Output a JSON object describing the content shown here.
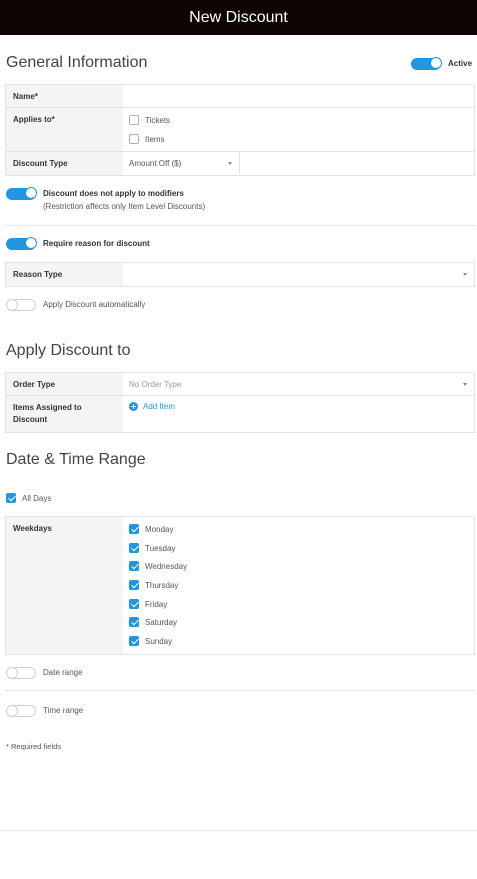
{
  "header": {
    "title": "New Discount"
  },
  "general": {
    "title": "General Information",
    "active_label": "Active",
    "name_label": "Name*",
    "name_value": "",
    "applies_label": "Applies to*",
    "applies_options": [
      "Tickets",
      "Items"
    ],
    "discount_type_label": "Discount Type",
    "discount_type_value": "Amount Off ($)",
    "modifiers_label": "Discount does not apply to modifiers",
    "modifiers_sub": "(Restriction affects only Item Level Discounts)",
    "require_reason_label": "Require reason for discount",
    "reason_type_label": "Reason Type",
    "auto_label": "Apply Discount automatically"
  },
  "apply": {
    "title": "Apply Discount to",
    "order_type_label": "Order Type",
    "order_type_value": "No Order Type",
    "items_assigned_label": "Items Assigned to Discount",
    "add_item_label": "Add Item"
  },
  "datetime": {
    "title": "Date & Time Range",
    "all_days_label": "All Days",
    "weekdays_label": "Weekdays",
    "days": [
      "Monday",
      "Tuesday",
      "Wednesday",
      "Thursday",
      "Friday",
      "Saturday",
      "Sunday"
    ],
    "date_range_label": "Date range",
    "time_range_label": "Time range"
  },
  "footer": {
    "required_note": "* Required fields"
  },
  "colors": {
    "accent": "#2196e3",
    "header_bg": "#0d0303",
    "label_bg": "#f4f4f4"
  }
}
